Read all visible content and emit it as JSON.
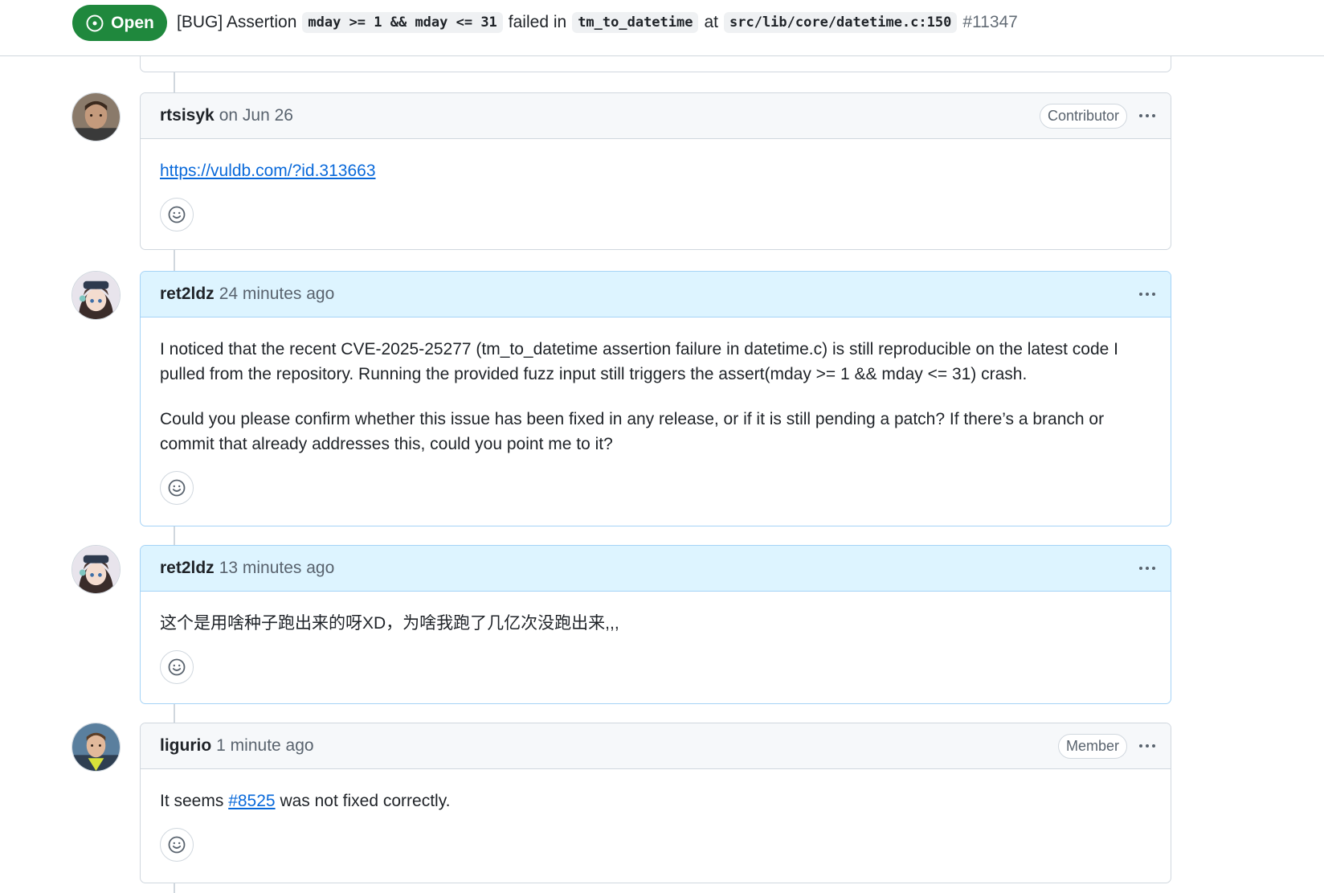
{
  "issue": {
    "state": "Open",
    "title_prefix": "[BUG] Assertion",
    "code_condition": "mday >= 1 && mday <= 31",
    "mid_text": "failed in",
    "code_function": "tm_to_datetime",
    "at_text": "at",
    "code_location": "src/lib/core/datetime.c:150",
    "number": "#11347"
  },
  "comments": [
    {
      "author": "rtsisyk",
      "time": "on Jun 26",
      "role": "Contributor",
      "link": "https://vuldb.com/?id.313663"
    },
    {
      "author": "ret2ldz",
      "time": "24 minutes ago",
      "paragraphs": [
        "I noticed that the recent CVE-2025-25277 (tm_to_datetime assertion failure in datetime.c) is still reproducible on the latest code I pulled from the repository. Running the provided fuzz input still triggers the assert(mday >= 1 && mday <= 31) crash.",
        "Could you please confirm whether this issue has been fixed in any release, or if it is still pending a patch? If there’s a branch or commit that already addresses this, could you point me to it?"
      ]
    },
    {
      "author": "ret2ldz",
      "time": "13 minutes ago",
      "text": "这个是用啥种子跑出来的呀XD，为啥我跑了几亿次没跑出来,,,"
    },
    {
      "author": "ligurio",
      "time": "1 minute ago",
      "role": "Member",
      "text_before": "It seems ",
      "ref_link": "#8525",
      "text_after": " was not fixed correctly."
    }
  ],
  "colors": {
    "open_green": "#1f883d",
    "link_blue": "#0969da",
    "author_header_bg": "#ddf4ff",
    "header_bg": "#f6f8fa",
    "border": "#d0d7de"
  },
  "icons": [
    "issue-opened-icon",
    "kebab-horizontal-icon",
    "smiley-icon",
    "avatar"
  ]
}
